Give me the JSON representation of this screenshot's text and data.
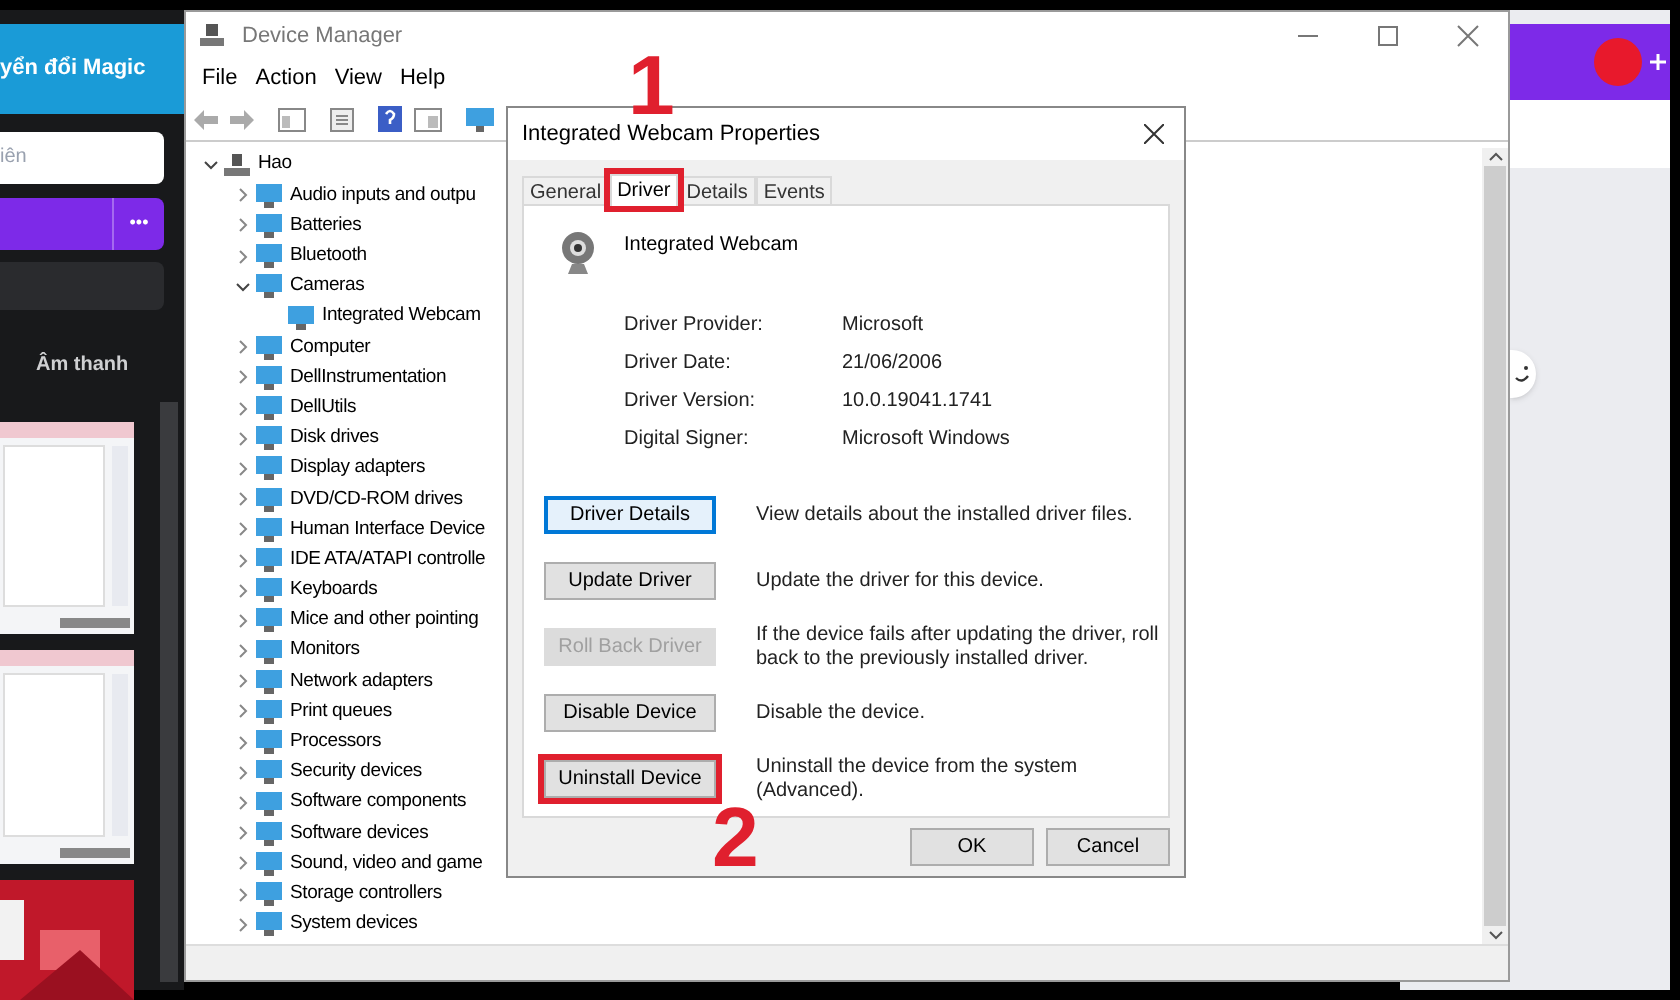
{
  "background_app": {
    "header_text": "yển đổi Magic",
    "search": {
      "placeholder": "iên"
    },
    "more_button": "•••",
    "tab_label": "Âm thanh"
  },
  "window": {
    "title": "Device Manager",
    "menu": [
      "File",
      "Action",
      "View",
      "Help"
    ],
    "tree": {
      "label": "Hao",
      "expanded": true,
      "children": [
        {
          "label": "Audio inputs and outpu",
          "expanded": false
        },
        {
          "label": "Batteries",
          "expanded": false
        },
        {
          "label": "Bluetooth",
          "expanded": false
        },
        {
          "label": "Cameras",
          "expanded": true,
          "children": [
            {
              "label": "Integrated Webcam"
            }
          ]
        },
        {
          "label": "Computer",
          "expanded": false
        },
        {
          "label": "DellInstrumentation",
          "expanded": false
        },
        {
          "label": "DellUtils",
          "expanded": false
        },
        {
          "label": "Disk drives",
          "expanded": false
        },
        {
          "label": "Display adapters",
          "expanded": false
        },
        {
          "label": "DVD/CD-ROM drives",
          "expanded": false
        },
        {
          "label": "Human Interface Device",
          "expanded": false
        },
        {
          "label": "IDE ATA/ATAPI controlle",
          "expanded": false
        },
        {
          "label": "Keyboards",
          "expanded": false
        },
        {
          "label": "Mice and other pointing",
          "expanded": false
        },
        {
          "label": "Monitors",
          "expanded": false
        },
        {
          "label": "Network adapters",
          "expanded": false
        },
        {
          "label": "Print queues",
          "expanded": false
        },
        {
          "label": "Processors",
          "expanded": false
        },
        {
          "label": "Security devices",
          "expanded": false
        },
        {
          "label": "Software components",
          "expanded": false
        },
        {
          "label": "Software devices",
          "expanded": false
        },
        {
          "label": "Sound, video and game",
          "expanded": false
        },
        {
          "label": "Storage controllers",
          "expanded": false
        },
        {
          "label": "System devices",
          "expanded": false
        }
      ]
    }
  },
  "dialog": {
    "title": "Integrated Webcam Properties",
    "tabs": [
      {
        "label": "General",
        "selected": false,
        "highlighted": false
      },
      {
        "label": "Driver",
        "selected": true,
        "highlighted": true
      },
      {
        "label": "Details",
        "selected": false,
        "highlighted": false
      },
      {
        "label": "Events",
        "selected": false,
        "highlighted": false
      }
    ],
    "device_name": "Integrated Webcam",
    "properties": [
      {
        "label": "Driver Provider:",
        "value": "Microsoft"
      },
      {
        "label": "Driver Date:",
        "value": "21/06/2006"
      },
      {
        "label": "Driver Version:",
        "value": "10.0.19041.1741"
      },
      {
        "label": "Digital Signer:",
        "value": "Microsoft Windows"
      }
    ],
    "actions": [
      {
        "button": "Driver Details",
        "description": "View details about the installed driver files.",
        "disabled": false,
        "focused": true,
        "highlighted": false
      },
      {
        "button": "Update Driver",
        "description": "Update the driver for this device.",
        "disabled": false,
        "focused": false,
        "highlighted": false
      },
      {
        "button": "Roll Back Driver",
        "description": "If the device fails after updating the driver, roll back to the previously installed driver.",
        "disabled": true,
        "focused": false,
        "highlighted": false
      },
      {
        "button": "Disable Device",
        "description": "Disable the device.",
        "disabled": false,
        "focused": false,
        "highlighted": false
      },
      {
        "button": "Uninstall Device",
        "description": "Uninstall the device from the system (Advanced).",
        "disabled": false,
        "focused": false,
        "highlighted": true
      }
    ],
    "buttons": [
      "OK",
      "Cancel"
    ]
  },
  "annotations": [
    "1",
    "2"
  ]
}
